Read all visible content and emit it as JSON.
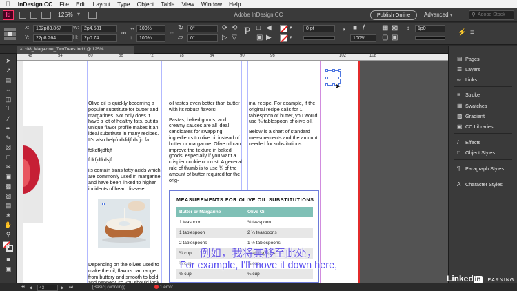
{
  "menubar": {
    "items": [
      "InDesign CC",
      "File",
      "Edit",
      "Layout",
      "Type",
      "Object",
      "Table",
      "View",
      "Window",
      "Help"
    ]
  },
  "appbar": {
    "logo_text": "Id",
    "zoom": "125%",
    "title": "Adobe InDesign CC",
    "publish_label": "Publish Online",
    "workspace_label": "Advanced",
    "search_placeholder": "Adobe Stock"
  },
  "control": {
    "x_label": "X:",
    "x_value": "102p83.867",
    "y_label": "Y:",
    "y_value": "22p8.264",
    "w_label": "W:",
    "w_value": "2p4.581",
    "h_label": "H:",
    "h_value": "2p0.74",
    "scale_x": "100%",
    "scale_y": "100%",
    "rotate": "0°",
    "shear": "0°",
    "stroke_weight": "0 pt",
    "reference": "1p0",
    "opacity": "100%"
  },
  "tab": {
    "label": "*08_Magazine_TwoTrees.indd @ 125%"
  },
  "ruler": {
    "ticks": [
      "48",
      "54",
      "60",
      "66",
      "72",
      "78",
      "84",
      "90",
      "96",
      "102",
      "108"
    ]
  },
  "document": {
    "col1": [
      "Olive oil is quickly becoming a popular substitute for butter and margarines. Not only does it have a lot of healthy fats, but its unique flavor profile makes it an ideal substitute in many recipes. It's also helpfudkfdjf dkfjd fa",
      "fdkdfkjdfkjf",
      "fdkfjdfkdsjf",
      "ils contain trans fatty acids which are commonly used in margarine and have been linked to higher incidents of heart disease."
    ],
    "col1_bottom": "Depending on the olives used to make the oil, flavors can range from buttery and smooth to bold and peppery, so you should look",
    "col2": [
      "oil tastes even better than butter with its robust flavors!",
      "Pastas, baked goods, and creamy sauces are all ideal candidates for swapping ingredients to olive oil instead of butter or margarine. Olive oil can improve the texture in baked goods, especially if you want a crispier cookie or crust. A general rule of thumb is to use ¾ of the amount of butter required for the orig-"
    ],
    "col3": [
      "inal recipe. For example, if the original recipe calls for 1 tablespoon of butter, you would use ¾ tablespoon of olive oil.",
      "Below is a chart of standard measurements and the amount needed for substitutions:"
    ]
  },
  "table": {
    "title": "MEASUREMENTS FOR OLIVE OIL SUBSTITUTIONS",
    "headers": [
      "Butter or Margarine",
      "Olive Oil"
    ],
    "rows": [
      [
        "1 teaspoon",
        "¾ teaspoon"
      ],
      [
        "1 tablespoon",
        "2 ¼ teaspoons"
      ],
      [
        "2 tablespoons",
        "1 ½ tablespoons"
      ],
      [
        "¼ cup",
        "3 tablespoons"
      ],
      [
        "⅓ cup",
        "¼ cup"
      ],
      [
        "½ cup",
        "¼ cup"
      ],
      [
        "⅔ cup",
        "½ cup"
      ]
    ]
  },
  "panels": {
    "items": [
      "Pages",
      "Layers",
      "Links",
      "Stroke",
      "Swatches",
      "Gradient",
      "CC Libraries",
      "Effects",
      "Object Styles",
      "Paragraph Styles",
      "Character Styles"
    ]
  },
  "status": {
    "page": "43",
    "style": "[Basic] (working)",
    "errors": "1 error"
  },
  "subtitles": {
    "zh": "例如，我将其移至此处，",
    "en": "For example, I'll move it down here,"
  },
  "watermark": {
    "brand": "Linked",
    "in": "in",
    "learning": "LEARNING"
  },
  "colors": {
    "table_header": "#7fc0b6",
    "guide_margin": "#c66fd6",
    "guide_column": "#9fa8ff",
    "page_edge": "#e32b2b",
    "subtitle": "#5a4ff0"
  }
}
